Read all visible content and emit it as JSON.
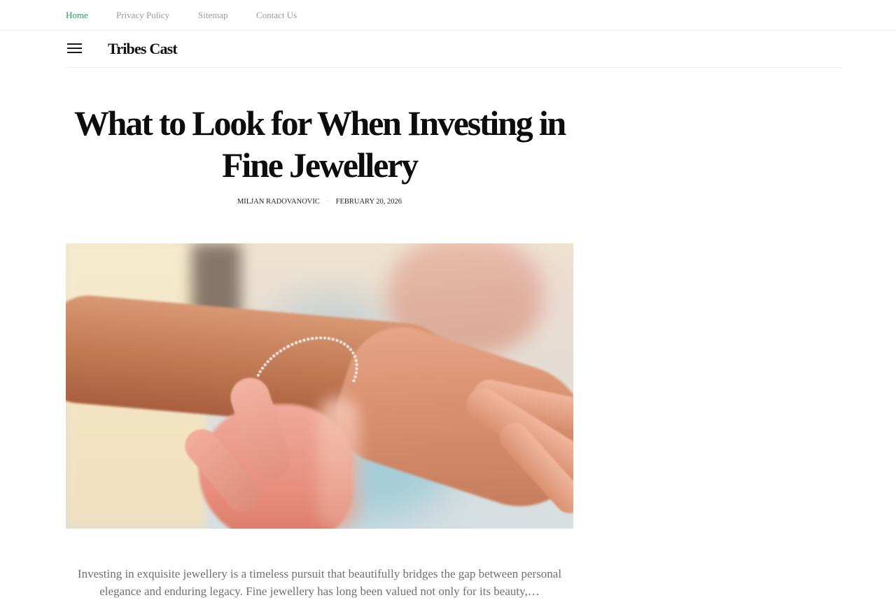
{
  "top_nav": {
    "items": [
      {
        "label": "Home",
        "active": true
      },
      {
        "label": "Privacy Policy",
        "active": false
      },
      {
        "label": "Sitemap",
        "active": false
      },
      {
        "label": "Contact Us",
        "active": false
      }
    ],
    "active_color": "#1e9e5a",
    "inactive_color": "#9a9a9a"
  },
  "header": {
    "menu_icon": "hamburger-menu-icon",
    "site_title": "Tribes Cast"
  },
  "article": {
    "title": "What to Look for When Investing in Fine Jewellery",
    "author": "MILJAN RADOVANOVIC",
    "separator": "·",
    "date": "FEBRUARY 20, 2026",
    "image_description": "featured-photo-bracelet",
    "excerpt": "Investing in exquisite jewellery is a timeless pursuit that beautifully bridges the gap between personal elegance and enduring legacy. Fine jewellery has long been valued not only for its beauty,…"
  }
}
